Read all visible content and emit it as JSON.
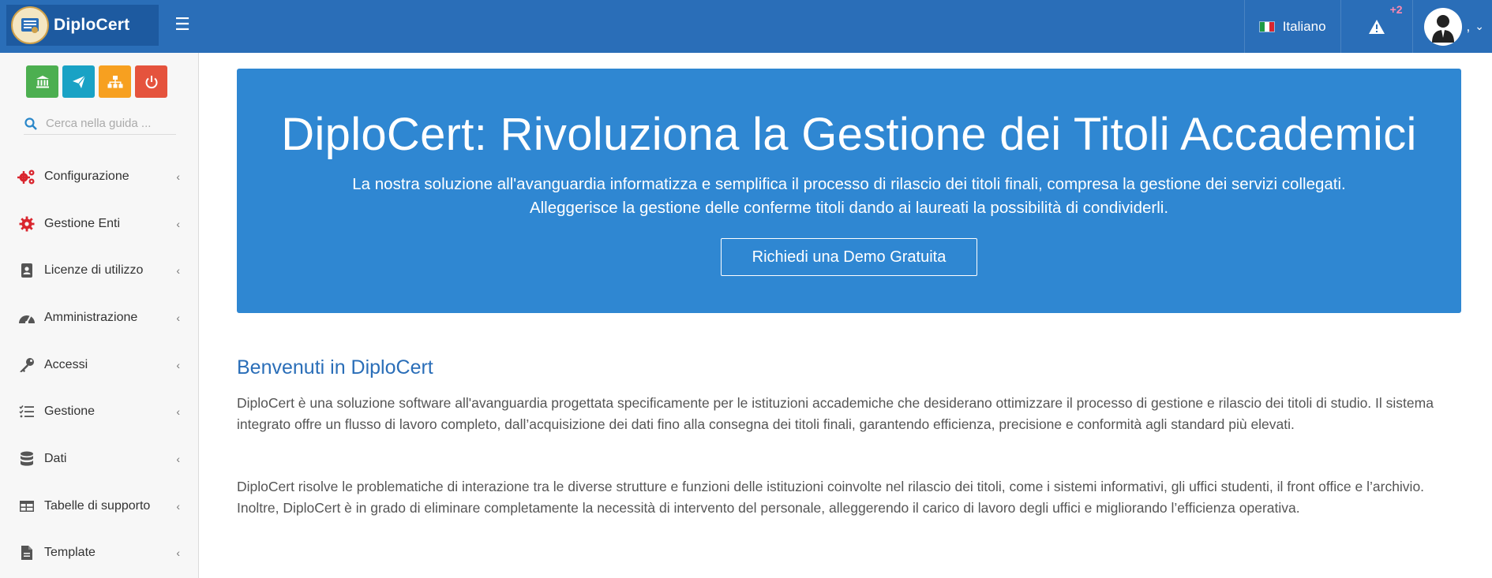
{
  "header": {
    "brand": "DiploCert",
    "menu_toggle": "☰",
    "language": "Italiano",
    "alert_badge": "+2",
    "user_name": ","
  },
  "sidebar": {
    "search_placeholder": "Cerca nella guida ...",
    "items": [
      {
        "label": "Configurazione",
        "icon": "gears-icon",
        "color": "#d9262f"
      },
      {
        "label": "Gestione Enti",
        "icon": "gear-icon",
        "color": "#d9262f"
      },
      {
        "label": "Licenze di utilizzo",
        "icon": "id-badge-icon",
        "color": "#555555"
      },
      {
        "label": "Amministrazione",
        "icon": "dashboard-icon",
        "color": "#555555"
      },
      {
        "label": "Accessi",
        "icon": "key-icon",
        "color": "#555555"
      },
      {
        "label": "Gestione",
        "icon": "tasks-icon",
        "color": "#555555"
      },
      {
        "label": "Dati",
        "icon": "database-icon",
        "color": "#555555"
      },
      {
        "label": "Tabelle di supporto",
        "icon": "table-icon",
        "color": "#555555"
      },
      {
        "label": "Template",
        "icon": "file-icon",
        "color": "#555555"
      }
    ]
  },
  "hero": {
    "title": "DiploCert: Rivoluziona la Gestione dei Titoli Accademici",
    "subtitle_line1": "La nostra soluzione all'avanguardia informatizza e semplifica il processo di rilascio dei titoli finali, compresa la gestione dei servizi collegati.",
    "subtitle_line2": "Alleggerisce la gestione delle conferme titoli dando ai laureati la possibilità di condividerli.",
    "cta": "Richiedi una Demo Gratuita"
  },
  "content": {
    "welcome_title": "Benvenuti in DiploCert",
    "paragraph1": "DiploCert è una soluzione software all'avanguardia progettata specificamente per le istituzioni accademiche che desiderano ottimizzare il processo di gestione e rilascio dei titoli di studio. Il sistema integrato offre un flusso di lavoro completo, dall’acquisizione dei dati fino alla consegna dei titoli finali, garantendo efficienza, precisione e conformità agli standard più elevati.",
    "paragraph2": "DiploCert risolve le problematiche di interazione tra le diverse strutture e funzioni delle istituzioni coinvolte nel rilascio dei titoli, come i sistemi informativi, gli uffici studenti, il front office e l’archivio. Inoltre, DiploCert è in grado di eliminare completamente la necessità di intervento del personale, alleggerendo il carico di lavoro degli uffici e migliorando l’efficienza operativa."
  },
  "colors": {
    "topbar": "#2a6eb8",
    "hero": "#2f87d2",
    "accent_red": "#d9262f"
  }
}
